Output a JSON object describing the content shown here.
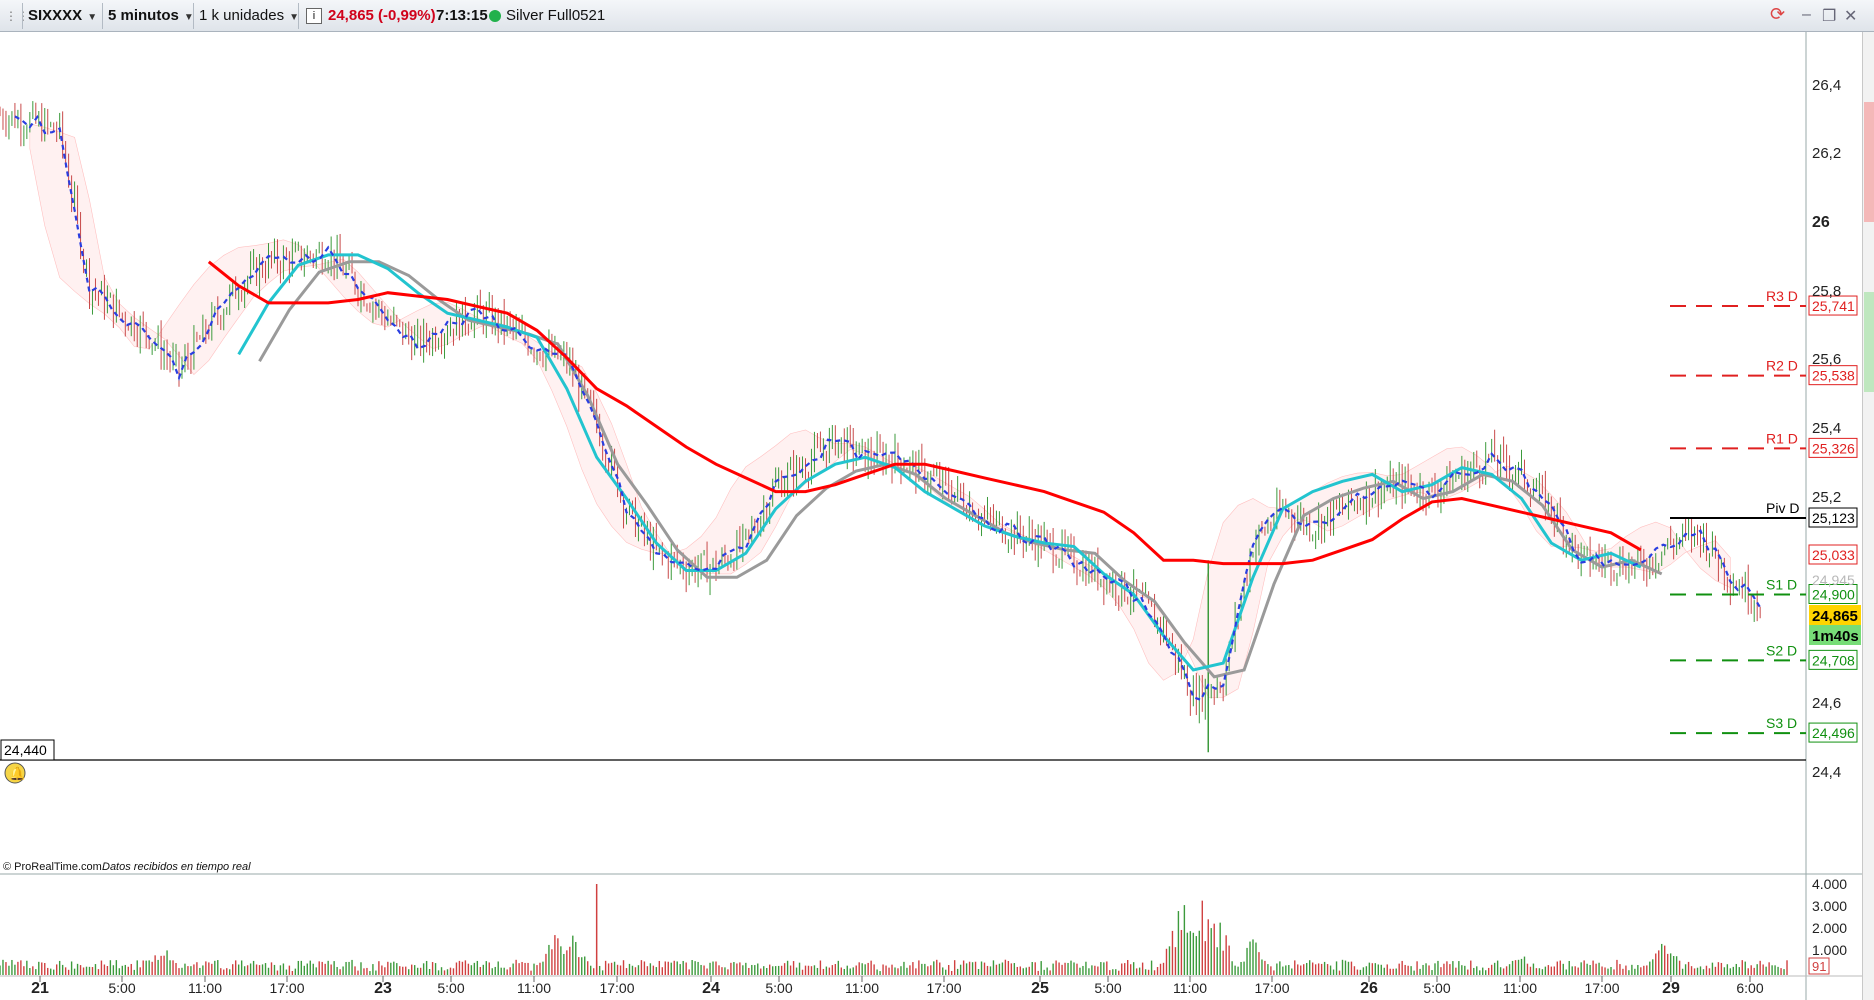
{
  "toolbar": {
    "symbol": "SIXXXX",
    "timeframe": "5 minutos",
    "units": "1 k unidades",
    "price": "24,865 (-0,99%)",
    "time": "7:13:15",
    "instrument": "Silver Full0521"
  },
  "colors": {
    "price_down": "#d0021b",
    "live_dot": "#22b14c",
    "ma_long": "#ff0000",
    "ma_fast": "#2a8be0",
    "ma_slow": "#9a9a9a",
    "ma_cyan": "#22c4cf",
    "pivot_resistance": "#e02020",
    "pivot_support": "#109010",
    "pivot_main": "#000000",
    "current_price_bg": "#ffd400",
    "timer_bg": "#77dd77"
  },
  "price_axis": {
    "ticks": [
      "26,4",
      "26,2",
      "26",
      "25,8",
      "25,6",
      "25,4",
      "25,2",
      "24,6",
      "24,4"
    ],
    "left_low_label": "24,440"
  },
  "levels": [
    {
      "name": "R3 D",
      "value": "25,741",
      "price": 25.741,
      "type": "resistance"
    },
    {
      "name": "R2 D",
      "value": "25,538",
      "price": 25.538,
      "type": "resistance"
    },
    {
      "name": "R1 D",
      "value": "25,326",
      "price": 25.326,
      "type": "resistance"
    },
    {
      "name": "Piv D",
      "value": "25,123",
      "price": 25.123,
      "type": "pivot"
    },
    {
      "name": "S1 D",
      "value": "24,900",
      "price": 24.9,
      "type": "support"
    },
    {
      "name": "S2 D",
      "value": "24,708",
      "price": 24.708,
      "type": "support"
    },
    {
      "name": "S3 D",
      "value": "24,496",
      "price": 24.496,
      "type": "support"
    }
  ],
  "axis_badges": {
    "ma_value": "25,033",
    "faded_value": "24,945",
    "current_price": "24,865",
    "timer": "1m40s"
  },
  "credits": {
    "brand": "© ProRealTime.com",
    "status": "Datos recibidos en tiempo real"
  },
  "volume_axis": {
    "ticks": [
      "4.000",
      "3.000",
      "2.000",
      "1.000"
    ],
    "current": "91"
  },
  "time_axis": [
    {
      "label": "21",
      "bold": true
    },
    {
      "label": "5:00"
    },
    {
      "label": "11:00"
    },
    {
      "label": "17:00"
    },
    {
      "label": "23",
      "bold": true
    },
    {
      "label": "5:00"
    },
    {
      "label": "11:00"
    },
    {
      "label": "17:00"
    },
    {
      "label": "24",
      "bold": true
    },
    {
      "label": "5:00"
    },
    {
      "label": "11:00"
    },
    {
      "label": "17:00"
    },
    {
      "label": "25",
      "bold": true
    },
    {
      "label": "5:00"
    },
    {
      "label": "11:00"
    },
    {
      "label": "17:00"
    },
    {
      "label": "26",
      "bold": true
    },
    {
      "label": "5:00"
    },
    {
      "label": "11:00"
    },
    {
      "label": "17:00"
    },
    {
      "label": "29",
      "bold": true
    },
    {
      "label": "6:00"
    }
  ],
  "series": {
    "price_path": [
      [
        21,
        26.3
      ],
      [
        22,
        26.28
      ],
      [
        23,
        26.25
      ],
      [
        24,
        25.8
      ],
      [
        25,
        25.72
      ],
      [
        26,
        25.66
      ],
      [
        27,
        25.55
      ],
      [
        28,
        25.68
      ],
      [
        29,
        25.8
      ],
      [
        30,
        25.87
      ],
      [
        31,
        25.88
      ],
      [
        32,
        25.9
      ],
      [
        33,
        25.8
      ],
      [
        34,
        25.7
      ],
      [
        35,
        25.63
      ],
      [
        36,
        25.68
      ],
      [
        37,
        25.72
      ],
      [
        38,
        25.68
      ],
      [
        39,
        25.62
      ],
      [
        40,
        25.58
      ],
      [
        41,
        25.4
      ],
      [
        42,
        25.15
      ],
      [
        43,
        25.02
      ],
      [
        44,
        24.98
      ],
      [
        45,
        24.98
      ],
      [
        46,
        25.05
      ],
      [
        47,
        25.22
      ],
      [
        48,
        25.28
      ],
      [
        49,
        25.35
      ],
      [
        50,
        25.3
      ],
      [
        51,
        25.3
      ],
      [
        52,
        25.25
      ],
      [
        53,
        25.2
      ],
      [
        54,
        25.12
      ],
      [
        55,
        25.08
      ],
      [
        56,
        25.05
      ],
      [
        57,
        25.0
      ],
      [
        58,
        24.95
      ],
      [
        59,
        24.9
      ],
      [
        60,
        24.8
      ],
      [
        61,
        24.6
      ],
      [
        62,
        24.65
      ],
      [
        63,
        25.05
      ],
      [
        64,
        25.15
      ],
      [
        65,
        25.1
      ],
      [
        66,
        25.15
      ],
      [
        67,
        25.2
      ],
      [
        68,
        25.22
      ],
      [
        69,
        25.2
      ],
      [
        70,
        25.25
      ],
      [
        71,
        25.3
      ],
      [
        72,
        25.25
      ],
      [
        73,
        25.15
      ],
      [
        74,
        25.0
      ],
      [
        75,
        25.0
      ],
      [
        76,
        24.98
      ],
      [
        77,
        25.05
      ],
      [
        78,
        25.08
      ],
      [
        79,
        24.95
      ],
      [
        80,
        24.88
      ]
    ],
    "ma_long": [
      [
        28,
        25.87
      ],
      [
        29,
        25.8
      ],
      [
        30,
        25.75
      ],
      [
        31,
        25.75
      ],
      [
        32,
        25.75
      ],
      [
        33,
        25.76
      ],
      [
        34,
        25.78
      ],
      [
        35,
        25.77
      ],
      [
        36,
        25.76
      ],
      [
        37,
        25.74
      ],
      [
        38,
        25.72
      ],
      [
        39,
        25.67
      ],
      [
        40,
        25.59
      ],
      [
        41,
        25.5
      ],
      [
        42,
        25.45
      ],
      [
        43,
        25.39
      ],
      [
        44,
        25.33
      ],
      [
        45,
        25.28
      ],
      [
        46,
        25.24
      ],
      [
        47,
        25.2
      ],
      [
        48,
        25.2
      ],
      [
        49,
        25.22
      ],
      [
        50,
        25.25
      ],
      [
        51,
        25.28
      ],
      [
        52,
        25.28
      ],
      [
        53,
        25.26
      ],
      [
        54,
        25.24
      ],
      [
        55,
        25.22
      ],
      [
        56,
        25.2
      ],
      [
        57,
        25.17
      ],
      [
        58,
        25.14
      ],
      [
        59,
        25.08
      ],
      [
        60,
        25.0
      ],
      [
        61,
        25.0
      ],
      [
        62,
        24.99
      ],
      [
        63,
        24.99
      ],
      [
        64,
        24.99
      ],
      [
        65,
        25.0
      ],
      [
        66,
        25.03
      ],
      [
        67,
        25.06
      ],
      [
        68,
        25.12
      ],
      [
        69,
        25.17
      ],
      [
        70,
        25.18
      ],
      [
        71,
        25.16
      ],
      [
        72,
        25.14
      ],
      [
        73,
        25.12
      ],
      [
        74,
        25.1
      ],
      [
        75,
        25.08
      ],
      [
        76,
        25.03
      ]
    ],
    "ma_cyan": [
      [
        29,
        25.6
      ],
      [
        30,
        25.75
      ],
      [
        31,
        25.86
      ],
      [
        32,
        25.89
      ],
      [
        33,
        25.89
      ],
      [
        34,
        25.85
      ],
      [
        35,
        25.78
      ],
      [
        36,
        25.72
      ],
      [
        37,
        25.7
      ],
      [
        38,
        25.68
      ],
      [
        39,
        25.65
      ],
      [
        40,
        25.5
      ],
      [
        41,
        25.3
      ],
      [
        42,
        25.18
      ],
      [
        43,
        25.05
      ],
      [
        44,
        24.97
      ],
      [
        45,
        24.97
      ],
      [
        46,
        25.02
      ],
      [
        47,
        25.15
      ],
      [
        48,
        25.23
      ],
      [
        49,
        25.28
      ],
      [
        50,
        25.3
      ],
      [
        51,
        25.27
      ],
      [
        52,
        25.2
      ],
      [
        53,
        25.15
      ],
      [
        54,
        25.1
      ],
      [
        55,
        25.07
      ],
      [
        56,
        25.05
      ],
      [
        57,
        25.04
      ],
      [
        58,
        24.96
      ],
      [
        59,
        24.9
      ],
      [
        60,
        24.78
      ],
      [
        61,
        24.68
      ],
      [
        62,
        24.7
      ],
      [
        63,
        24.95
      ],
      [
        64,
        25.15
      ],
      [
        65,
        25.2
      ],
      [
        66,
        25.23
      ],
      [
        67,
        25.25
      ],
      [
        68,
        25.2
      ],
      [
        69,
        25.22
      ],
      [
        70,
        25.27
      ],
      [
        71,
        25.25
      ],
      [
        72,
        25.18
      ],
      [
        73,
        25.05
      ],
      [
        74,
        25.0
      ],
      [
        75,
        25.02
      ],
      [
        76,
        24.98
      ]
    ]
  },
  "volume_bars": [
    [
      0.01,
      4
    ],
    [
      0.05,
      3
    ],
    [
      0.09,
      12
    ],
    [
      0.11,
      3
    ],
    [
      0.14,
      4
    ],
    [
      0.18,
      5
    ],
    [
      0.22,
      4
    ],
    [
      0.26,
      6
    ],
    [
      0.31,
      18
    ],
    [
      0.32,
      16
    ],
    [
      0.36,
      4
    ],
    [
      0.4,
      3
    ],
    [
      0.44,
      5
    ],
    [
      0.48,
      4
    ],
    [
      0.52,
      5
    ],
    [
      0.56,
      6
    ],
    [
      0.6,
      4
    ],
    [
      0.66,
      33
    ],
    [
      0.67,
      40
    ],
    [
      0.68,
      25
    ],
    [
      0.7,
      14
    ],
    [
      0.73,
      5
    ],
    [
      0.77,
      4
    ],
    [
      0.81,
      5
    ],
    [
      0.85,
      7
    ],
    [
      0.89,
      5
    ],
    [
      0.93,
      15
    ],
    [
      0.96,
      4
    ],
    [
      0.99,
      3
    ]
  ]
}
